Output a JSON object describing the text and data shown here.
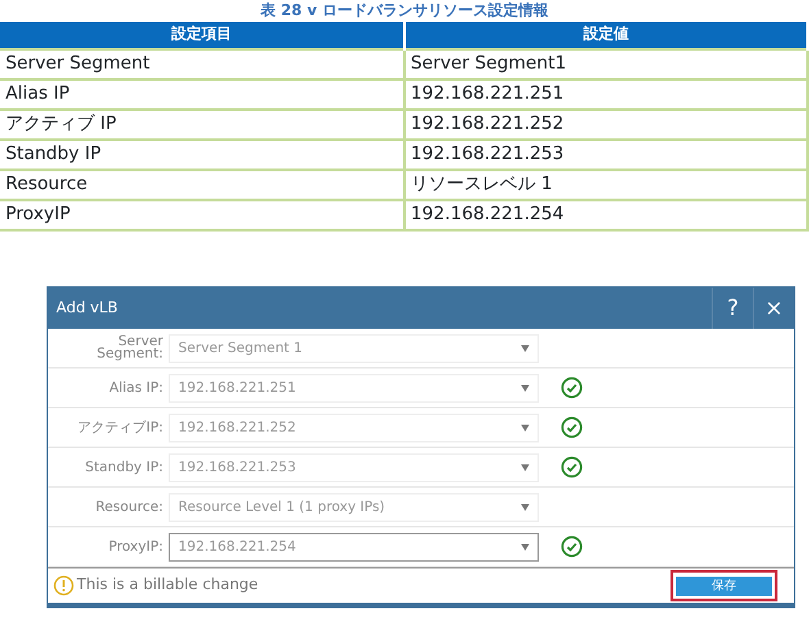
{
  "caption": "表 28 v ロードバランサリソース設定情報",
  "table": {
    "columns": [
      "設定項目",
      "設定値"
    ],
    "rows": [
      [
        "Server Segment",
        "Server Segment1"
      ],
      [
        "Alias IP",
        "192.168.221.251"
      ],
      [
        "アクティブ IP",
        "192.168.221.252"
      ],
      [
        "Standby IP",
        "192.168.221.253"
      ],
      [
        "Resource",
        "リソースレベル 1"
      ],
      [
        "ProxyIP",
        "192.168.221.254"
      ]
    ]
  },
  "dialog": {
    "title": "Add vLB",
    "help": "?",
    "close": "×",
    "fields": [
      {
        "label": "Server Segment:",
        "value": "Server Segment 1",
        "valid": false,
        "focused": false
      },
      {
        "label": "Alias IP:",
        "value": "192.168.221.251",
        "valid": true,
        "focused": false
      },
      {
        "label": "アクティブIP:",
        "value": "192.168.221.252",
        "valid": true,
        "focused": false
      },
      {
        "label": "Standby IP:",
        "value": "192.168.221.253",
        "valid": true,
        "focused": false
      },
      {
        "label": "Resource:",
        "value": "Resource Level 1 (1 proxy IPs)",
        "valid": false,
        "focused": false
      },
      {
        "label": "ProxyIP:",
        "value": "192.168.221.254",
        "valid": true,
        "focused": true
      }
    ],
    "notice": "This is a billable change",
    "save": "保存",
    "save_highlighted": true
  }
}
